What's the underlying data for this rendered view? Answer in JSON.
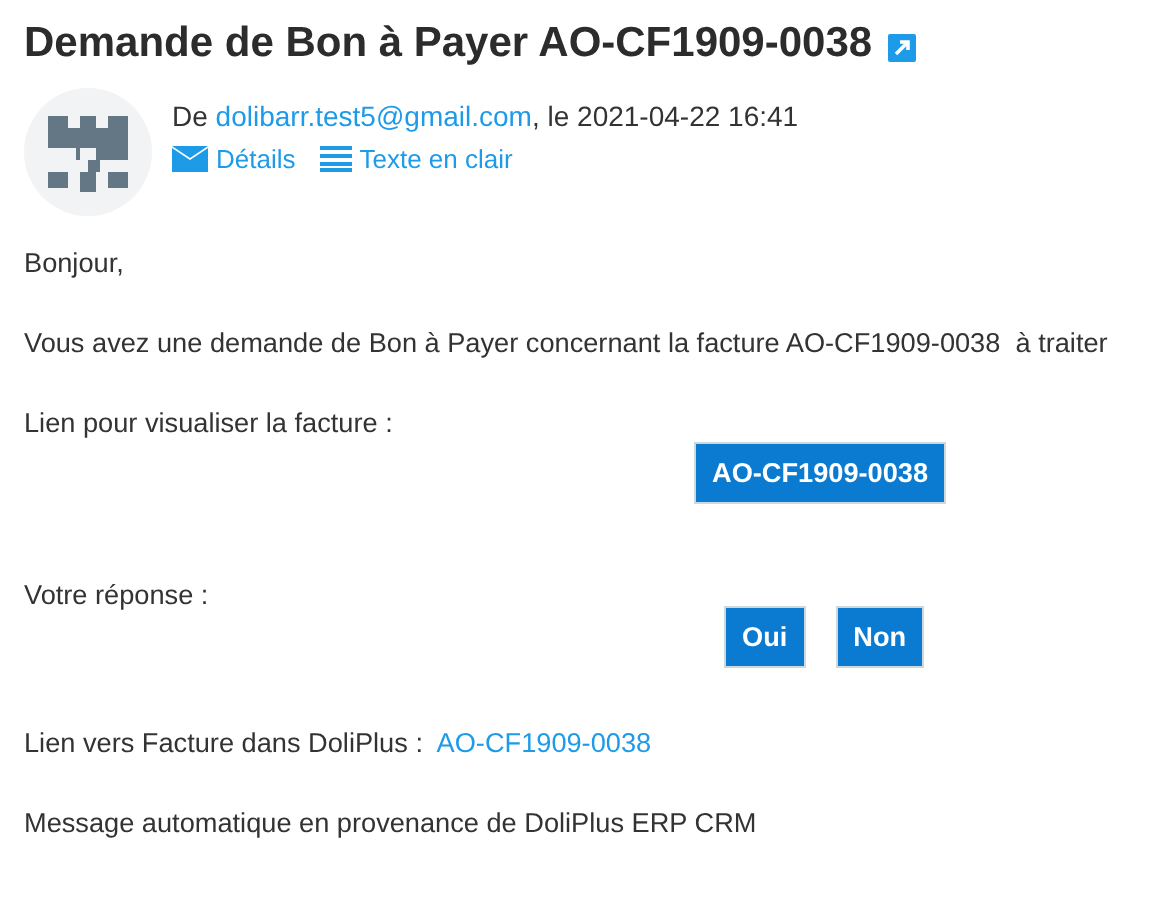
{
  "title": "Demande de Bon à Payer AO-CF1909-0038",
  "sender": {
    "prefix": "De ",
    "email": "dolibarr.test5@gmail.com",
    "suffix": ", le 2021-04-22 16:41"
  },
  "links": [
    {
      "kind": "mail",
      "label": "Détails"
    },
    {
      "kind": "list",
      "label": "Texte en clair"
    }
  ],
  "body": {
    "greeting": "Bonjour,",
    "request": "Vous avez une demande de Bon à Payer concernant la facture AO-CF1909-0038  à traiter",
    "view_label": "Lien pour visualiser la facture :",
    "view_button": "AO-CF1909-0038",
    "answer_label": "Votre réponse :",
    "answer_buttons": [
      "Oui",
      "Non"
    ],
    "doliplus_label": "Lien vers Facture dans DoliPlus :",
    "doliplus_link": "AO-CF1909-0038",
    "footer": "Message automatique en provenance de DoliPlus ERP CRM"
  }
}
